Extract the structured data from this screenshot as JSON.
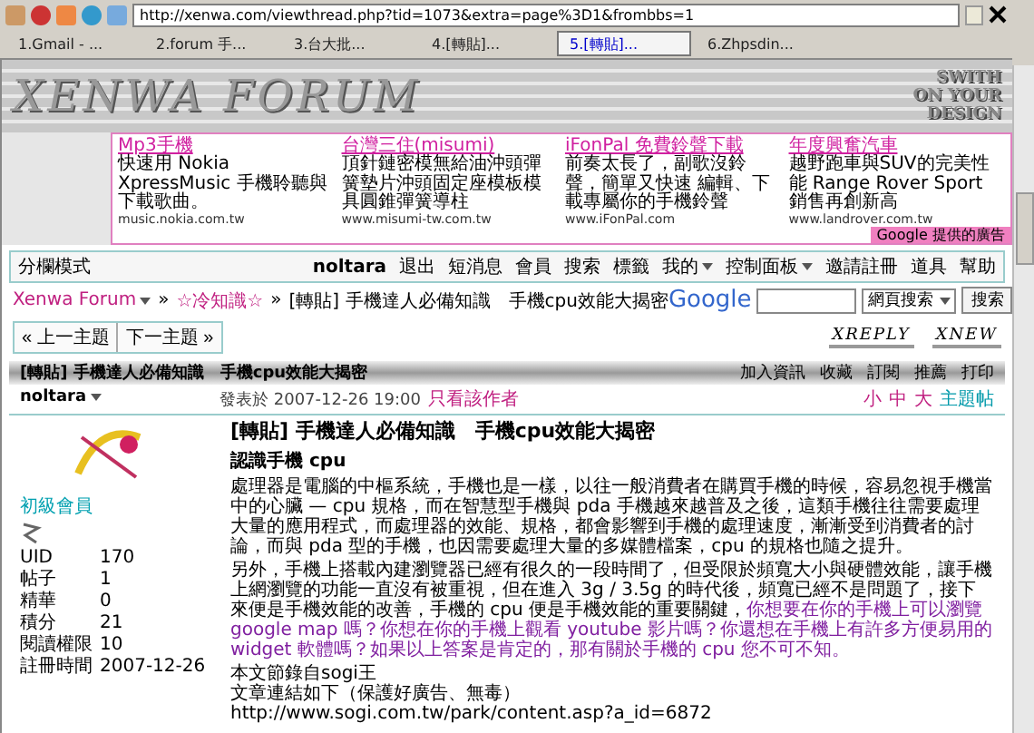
{
  "browser": {
    "address": "http://xenwa.com/viewthread.php?tid=1073&extra=page%3D1&frombbs=1",
    "tabs": [
      {
        "label": "1.Gmail - ...",
        "selected": false
      },
      {
        "label": "2.forum 手...",
        "selected": false
      },
      {
        "label": "3.台大批...",
        "selected": false
      },
      {
        "label": "4.[轉貼]...",
        "selected": false
      },
      {
        "label": "5.[轉貼]...",
        "selected": true
      },
      {
        "label": "6.Zhpsdin...",
        "selected": false
      }
    ]
  },
  "banner": {
    "logo": "XENWA FORUM",
    "slogan": [
      "SWITH",
      "ON YOUR",
      "DESIGN"
    ]
  },
  "ads": {
    "items": [
      {
        "title": "Mp3手機",
        "text": "快速用 Nokia XpressMusic 手機聆聽與下載歌曲。",
        "url": "music.nokia.com.tw"
      },
      {
        "title": "台灣三住(misumi)",
        "text": "頂針鏈密模無給油沖頭彈簧墊片沖頭固定座模板模具圓錐彈簧導柱",
        "url": "www.misumi-tw.com.tw"
      },
      {
        "title": "iFonPal 免費鈴聲下載",
        "text": "前奏太長了，副歌沒鈴聲，簡單又快速 編輯、下載專屬你的手機鈴聲",
        "url": "www.iFonPal.com"
      },
      {
        "title": "年度興奮汽車",
        "text": "越野跑車與SUV的完美性能 Range Rover Sport 銷售再創新高",
        "url": "www.landrover.com.tw"
      }
    ],
    "badge_brand": "Google",
    "badge_text": "提供的廣告"
  },
  "nav": {
    "mode": "分欄模式",
    "user": "noltara",
    "links": [
      {
        "label": "退出",
        "dropdown": false
      },
      {
        "label": "短消息",
        "dropdown": false
      },
      {
        "label": "會員",
        "dropdown": false
      },
      {
        "label": "搜索",
        "dropdown": false
      },
      {
        "label": "標籤",
        "dropdown": false
      },
      {
        "label": "我的",
        "dropdown": true
      },
      {
        "label": "控制面板",
        "dropdown": true
      },
      {
        "label": "邀請註冊",
        "dropdown": false
      },
      {
        "label": "道具",
        "dropdown": false
      },
      {
        "label": "幫助",
        "dropdown": false
      }
    ]
  },
  "breadcrumb": {
    "forum": "Xenwa Forum",
    "separator": "»",
    "board": "☆冷知識☆",
    "thread": "[轉貼] 手機達人必備知識　手機cpu效能大揭密"
  },
  "search": {
    "brand": "Google",
    "scope": "網頁搜索",
    "button": "搜索"
  },
  "pager": {
    "prev": "« 上一主題",
    "next": "下一主題 »"
  },
  "actions": {
    "reply": "XREPLY",
    "new": "XNEW"
  },
  "thread_bar": {
    "title": "[轉貼] 手機達人必備知識　手機cpu效能大揭密",
    "tools": [
      "加入資訊",
      "收藏",
      "訂閱",
      "推薦",
      "打印"
    ]
  },
  "post": {
    "author": "noltara",
    "rank": "初級會員",
    "stats": [
      {
        "label": "UID",
        "value": "170"
      },
      {
        "label": "帖子",
        "value": "1"
      },
      {
        "label": "精華",
        "value": "0"
      },
      {
        "label": "積分",
        "value": "21"
      },
      {
        "label": "閱讀權限",
        "value": "10"
      },
      {
        "label": "註冊時間",
        "value": "2007-12-26"
      }
    ],
    "posted": "發表於 2007-12-26 19:00",
    "author_only": "只看該作者",
    "sizes": [
      "小",
      "中",
      "大"
    ],
    "thread_link": "主題帖",
    "title": "[轉貼] 手機達人必備知識　手機cpu效能大揭密",
    "subtitle": "認識手機 cpu",
    "paragraphs": [
      [
        {
          "kind": "plain",
          "text": "處理器是電腦的中樞系統，手機也是一樣，以往一般消費者在購買手機的時候，容易忽視手機當中的心臟 — cpu 規格，而在智慧型手機與 pda 手機越來越普及之後，這類手機往往需要處理大量的應用程式，而處理器的效能、規格，都會影響到手機的處理速度，漸漸受到消費者的討論，而與 pda 型的手機，也因需要處理大量的多媒體檔案，cpu 的規格也隨之提升。"
        }
      ],
      [
        {
          "kind": "plain",
          "text": "另外，手機上搭載內建瀏覽器已經有很久的一段時間了，但受限於頻寬大小與硬體效能，讓手機上網瀏覽的功能一直沒有被重視，但在進入 3g / 3.5g 的時代後，頻寬已經不是問題了，接下來便是手機效能的改善，手機的 cpu 便是手機效能的重要關鍵，"
        },
        {
          "kind": "highlight",
          "text": "你想要在你的手機上可以瀏覽 google map 嗎？你想在你的手機上觀看 youtube 影片嗎？你還想在手機上有許多方便易用的 widget 軟體嗎？如果以上答案是肯定的，那有關於手機的 cpu 您不可不知。"
        }
      ]
    ],
    "source": [
      "本文節錄自sogi王",
      "文章連結如下（保護好廣告、無毒）",
      "http://www.sogi.com.tw/park/content.asp?a_id=6872"
    ]
  }
}
